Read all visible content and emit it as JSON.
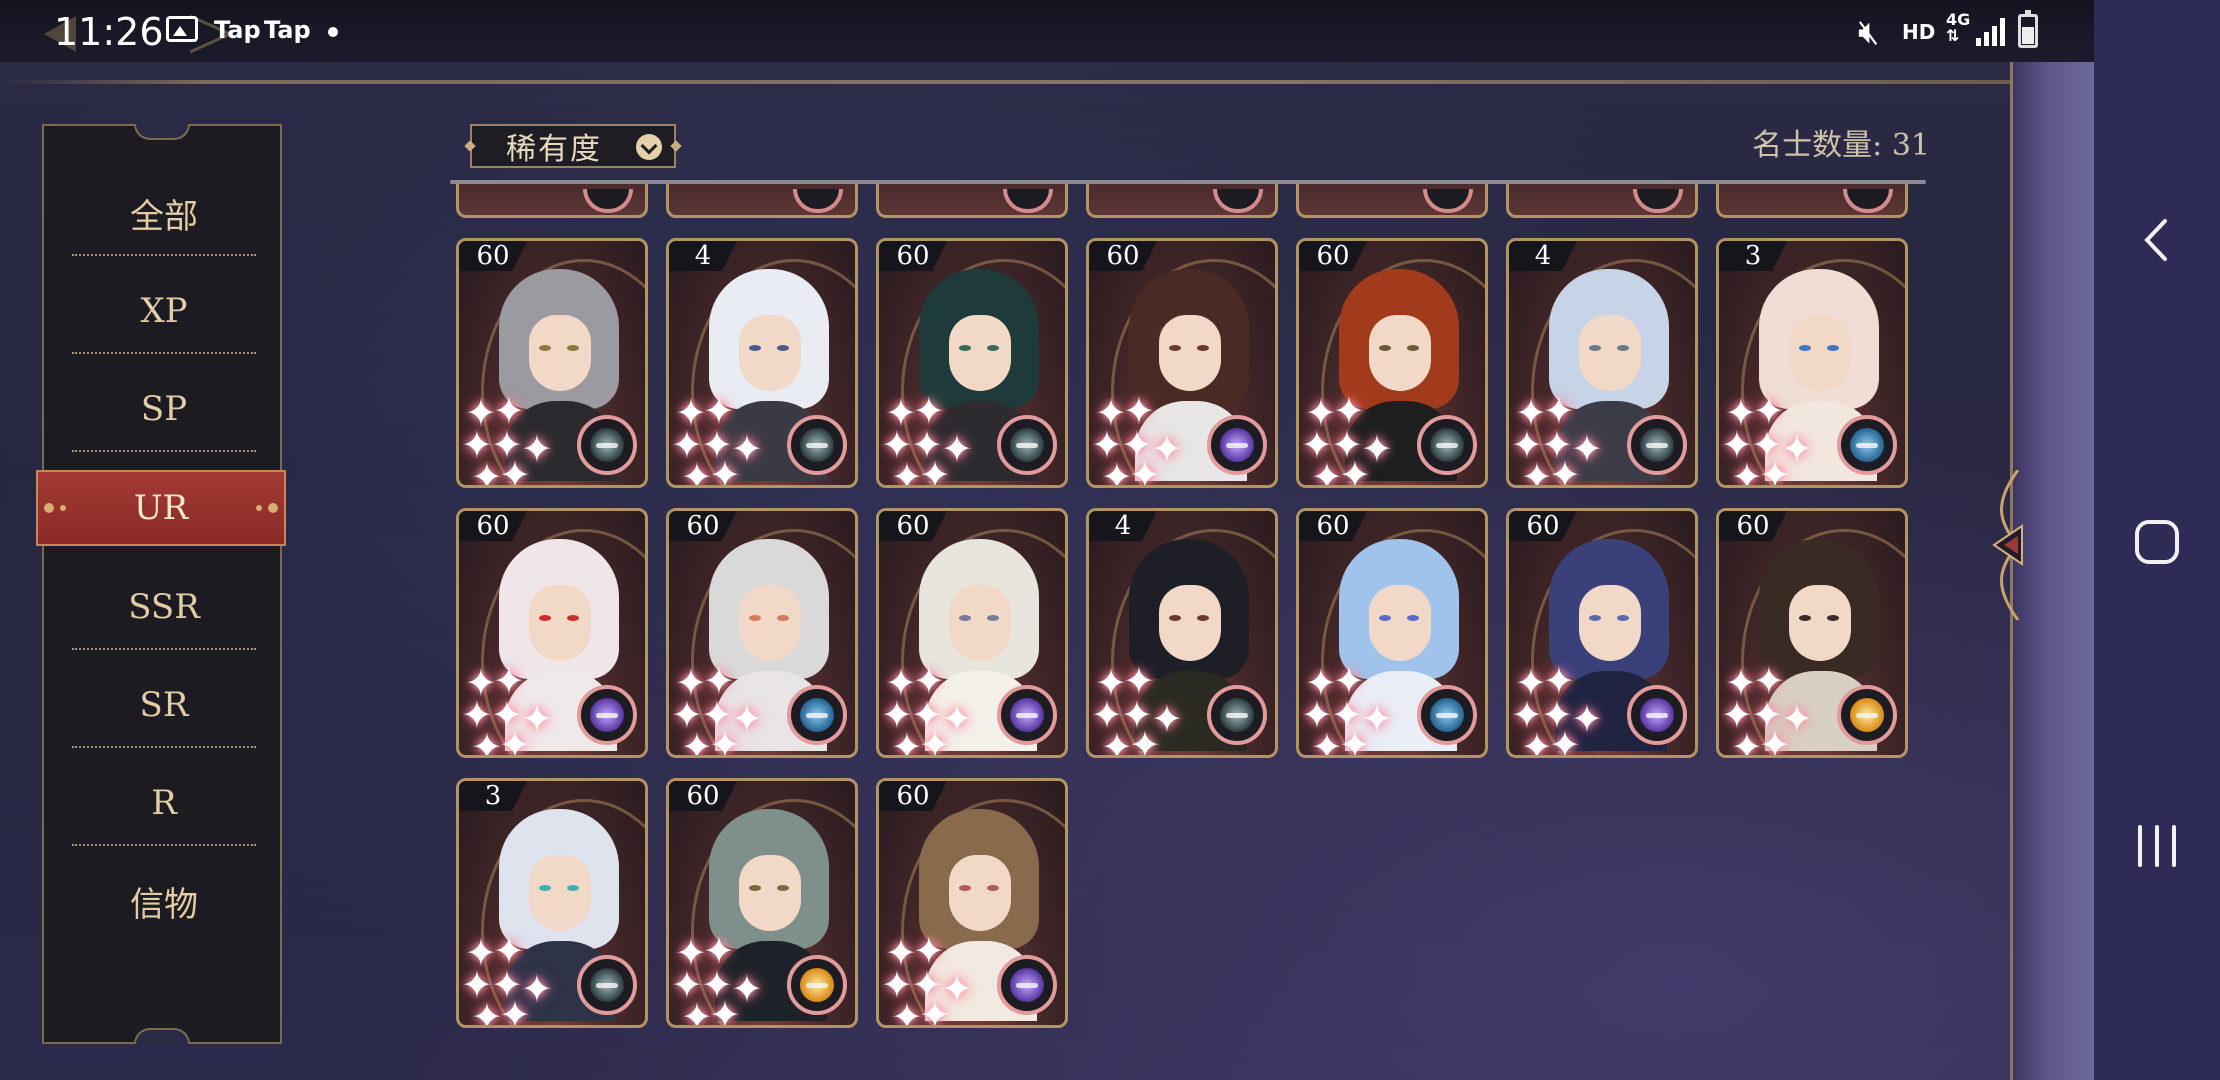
{
  "status_bar": {
    "time": "11:26",
    "notification_1": "Tap",
    "notification_2": "Tap",
    "hd": "HD",
    "network": "4G"
  },
  "toolbar": {
    "filter_label": "稀有度",
    "count_label": "名士数量: 31"
  },
  "categories": [
    {
      "label": "全部"
    },
    {
      "label": "XP"
    },
    {
      "label": "SP"
    },
    {
      "label": "UR",
      "active": true
    },
    {
      "label": "SSR"
    },
    {
      "label": "SR"
    },
    {
      "label": "R"
    },
    {
      "label": "信物"
    }
  ],
  "cards": [
    {
      "level": "60",
      "badge": "dark"
    },
    {
      "level": "4",
      "badge": "dark"
    },
    {
      "level": "60",
      "badge": "dark"
    },
    {
      "level": "60",
      "badge": "purple"
    },
    {
      "level": "60",
      "badge": "dark"
    },
    {
      "level": "4",
      "badge": "dark"
    },
    {
      "level": "3",
      "badge": "blue"
    },
    {
      "level": "60",
      "badge": "purple"
    },
    {
      "level": "60",
      "badge": "blue"
    },
    {
      "level": "60",
      "badge": "purple"
    },
    {
      "level": "4",
      "badge": "dark"
    },
    {
      "level": "60",
      "badge": "blue"
    },
    {
      "level": "60",
      "badge": "purple"
    },
    {
      "level": "60",
      "badge": "sun"
    },
    {
      "level": "3",
      "badge": "dark"
    },
    {
      "level": "60",
      "badge": "sun"
    },
    {
      "level": "60",
      "badge": "purple"
    }
  ],
  "icons": {
    "back": "chevron-left-icon",
    "home": "home-icon",
    "recents": "recents-icon"
  }
}
